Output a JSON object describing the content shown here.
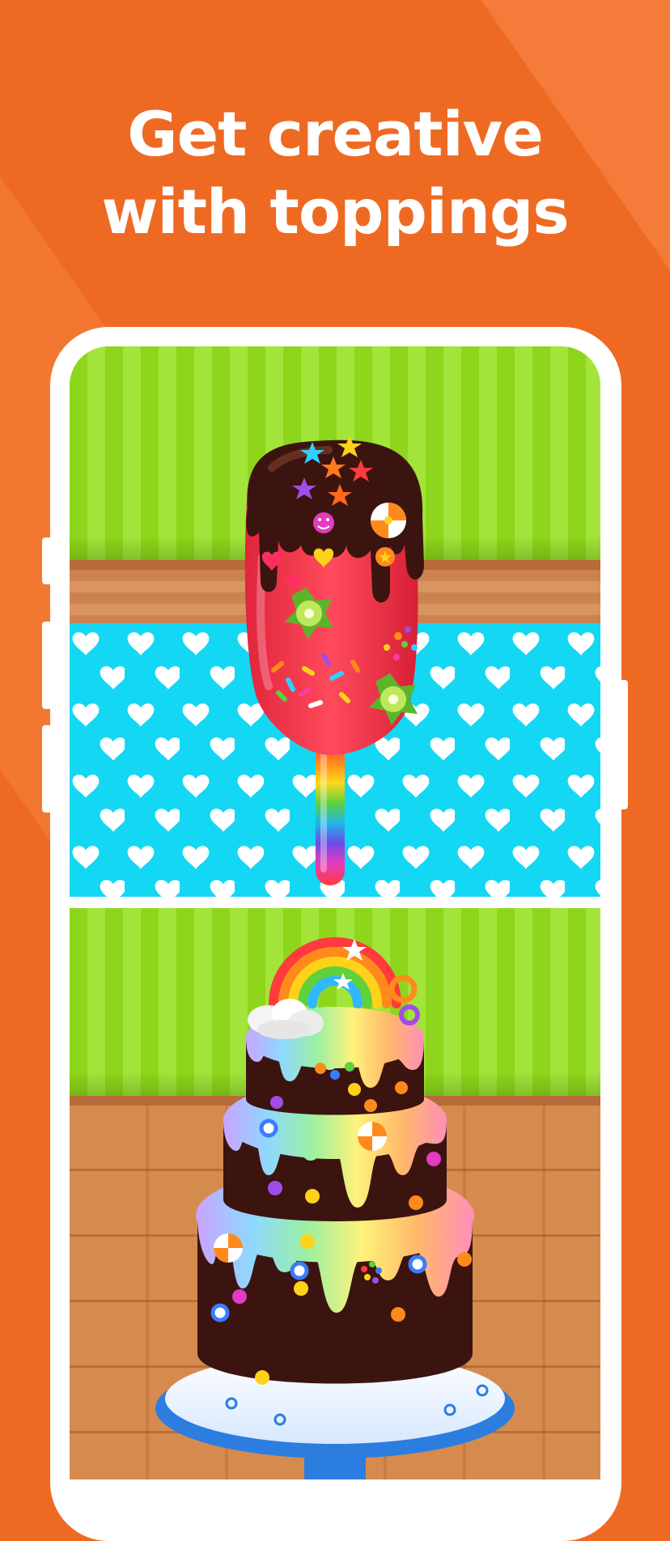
{
  "headline": {
    "line1": "Get creative",
    "line2": "with toppings"
  },
  "colors": {
    "background": "#ee6a23",
    "headline_text": "#ffffff",
    "phone_frame": "#ffffff",
    "wall_green": "#8ed61b",
    "tablecloth_blue": "#14d7f3",
    "chocolate": "#3b1410",
    "popsicle_red": "#f0334a"
  },
  "scenes": [
    {
      "name": "popsicle-scene",
      "items": [
        "chocolate-drip-icon",
        "star-sprinkle-icon",
        "kiwi-slice-icon",
        "lollipop-candy-icon",
        "rainbow-stick-icon"
      ]
    },
    {
      "name": "cake-scene",
      "items": [
        "rainbow-topper-icon",
        "cloud-topper-icon",
        "candy-ball-icon",
        "swirl-candy-icon",
        "cake-stand-icon"
      ]
    }
  ]
}
